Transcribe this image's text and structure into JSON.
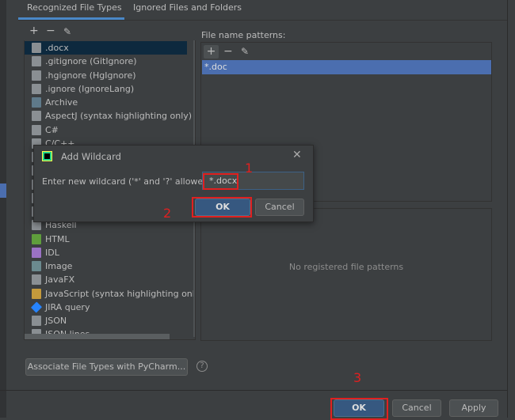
{
  "tabs": [
    {
      "label": "Recognized File Types",
      "active": true
    },
    {
      "label": "Ignored Files and Folders",
      "active": false
    }
  ],
  "toolbar": {
    "add": "+",
    "remove": "−",
    "edit": "✎"
  },
  "file_types": [
    {
      "label": ".docx",
      "selected": true,
      "icon": "user-file-icon"
    },
    {
      "label": ".gitignore (GitIgnore)",
      "icon": "ignore-file-icon"
    },
    {
      "label": ".hgignore (HgIgnore)",
      "icon": "ignore-file-icon"
    },
    {
      "label": ".ignore (IgnoreLang)",
      "icon": "ignore-file-icon"
    },
    {
      "label": "Archive",
      "icon": "archive-icon"
    },
    {
      "label": "AspectJ (syntax highlighting only)",
      "icon": "user-file-icon"
    },
    {
      "label": "C#",
      "icon": "user-file-icon"
    },
    {
      "label": "C/C++",
      "icon": "user-file-icon"
    },
    {
      "label": "",
      "icon": "file-icon"
    },
    {
      "label": "",
      "icon": "file-icon"
    },
    {
      "label": "",
      "icon": "file-icon"
    },
    {
      "label": "",
      "icon": "file-icon"
    },
    {
      "label": "",
      "icon": "file-icon"
    },
    {
      "label": "Haskell",
      "icon": "user-file-icon"
    },
    {
      "label": "HTML",
      "icon": "html-icon"
    },
    {
      "label": "IDL",
      "icon": "idl-icon"
    },
    {
      "label": "Image",
      "icon": "image-icon"
    },
    {
      "label": "JavaFX",
      "icon": "user-file-icon"
    },
    {
      "label": "JavaScript (syntax highlighting only)",
      "icon": "js-icon"
    },
    {
      "label": "JIRA query",
      "icon": "jira-icon"
    },
    {
      "label": "JSON",
      "icon": "json-icon"
    },
    {
      "label": "JSON lines",
      "icon": "json-icon"
    }
  ],
  "patterns": {
    "header": "File name patterns:",
    "items": [
      "*.doc"
    ],
    "empty": "No registered file patterns"
  },
  "associate_button": "Associate File Types with PyCharm...",
  "help": "?",
  "dialog": {
    "title": "Add Wildcard",
    "label": "Enter new wildcard ('*' and '?' allowed):",
    "value": "*.docx",
    "ok": "OK",
    "cancel": "Cancel",
    "close": "✕"
  },
  "footer": {
    "ok": "OK",
    "cancel": "Cancel",
    "apply": "Apply"
  },
  "annotations": [
    "1",
    "2",
    "3"
  ],
  "colors": {
    "accent": "#4a88c7",
    "selection": "#4b6eaf",
    "annotation": "#e02020"
  }
}
